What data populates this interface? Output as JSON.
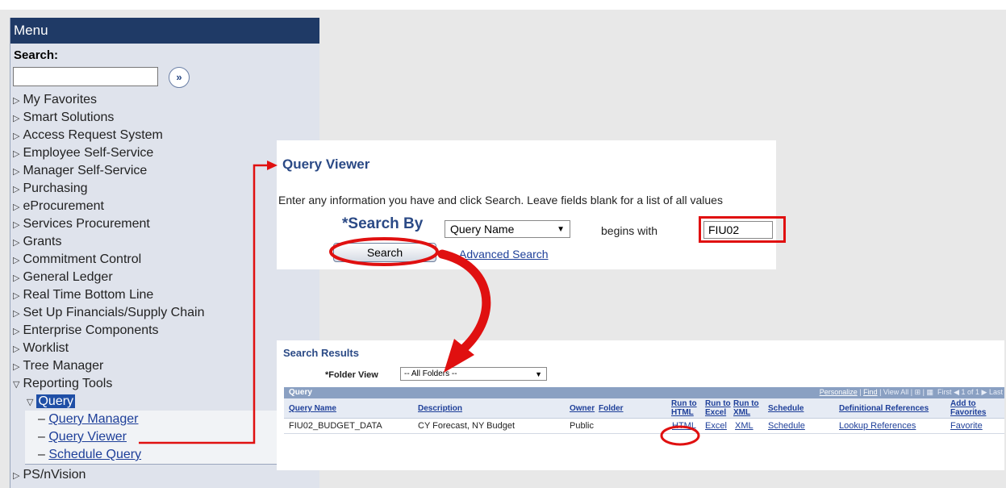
{
  "menu": {
    "header": "Menu",
    "search_label": "Search:",
    "go_glyph": "»",
    "items": [
      {
        "label": "My Favorites"
      },
      {
        "label": "Smart Solutions"
      },
      {
        "label": "Access Request System"
      },
      {
        "label": "Employee Self-Service"
      },
      {
        "label": "Manager Self-Service"
      },
      {
        "label": "Purchasing"
      },
      {
        "label": "eProcurement"
      },
      {
        "label": "Services Procurement"
      },
      {
        "label": "Grants"
      },
      {
        "label": "Commitment Control"
      },
      {
        "label": "General Ledger"
      },
      {
        "label": "Real Time Bottom Line"
      },
      {
        "label": "Set Up Financials/Supply Chain"
      },
      {
        "label": "Enterprise Components"
      },
      {
        "label": "Worklist"
      },
      {
        "label": "Tree Manager"
      },
      {
        "label": "Reporting Tools"
      }
    ],
    "query_label": "Query",
    "query_children": [
      {
        "label": "Query Manager"
      },
      {
        "label": "Query Viewer"
      },
      {
        "label": "Schedule Query"
      }
    ],
    "last_item": "PS/nVision"
  },
  "query_viewer": {
    "title": "Query Viewer",
    "instructions": "Enter any information you have and click Search. Leave fields blank for a list of all values",
    "search_by_label": "*Search By",
    "search_by_value": "Query Name",
    "operator": "begins with",
    "search_value": "FIU02",
    "search_button": "Search",
    "advanced_link": "Advanced Search"
  },
  "results": {
    "title": "Search Results",
    "folder_view_label": "*Folder View",
    "folder_view_value": "-- All Folders --",
    "grid_title": "Query",
    "nav": {
      "personalize": "Personalize",
      "find": "Find",
      "view_all": "View All",
      "first": "First",
      "range": "1 of 1",
      "last": "Last"
    },
    "columns": {
      "query_name": "Query Name",
      "description": "Description",
      "owner": "Owner",
      "folder": "Folder",
      "run_html_1": "Run to",
      "run_html_2": "HTML",
      "run_excel_1": "Run to",
      "run_excel_2": "Excel",
      "run_xml_1": "Run to",
      "run_xml_2": "XML",
      "schedule": "Schedule",
      "def_refs": "Definitional References",
      "fav_1": "Add to",
      "fav_2": "Favorites"
    },
    "row": {
      "query_name": "FIU02_BUDGET_DATA",
      "description": "CY Forecast, NY Budget",
      "owner": "Public",
      "folder": "",
      "html": "HTML",
      "excel": "Excel",
      "xml": "XML",
      "schedule": "Schedule",
      "def_refs": "Lookup References",
      "favorite": "Favorite"
    }
  },
  "colors": {
    "menu_header": "#1f3a66",
    "link": "#1e3f99",
    "annotation": "#e01010",
    "grid_header": "#8aa0c2"
  }
}
